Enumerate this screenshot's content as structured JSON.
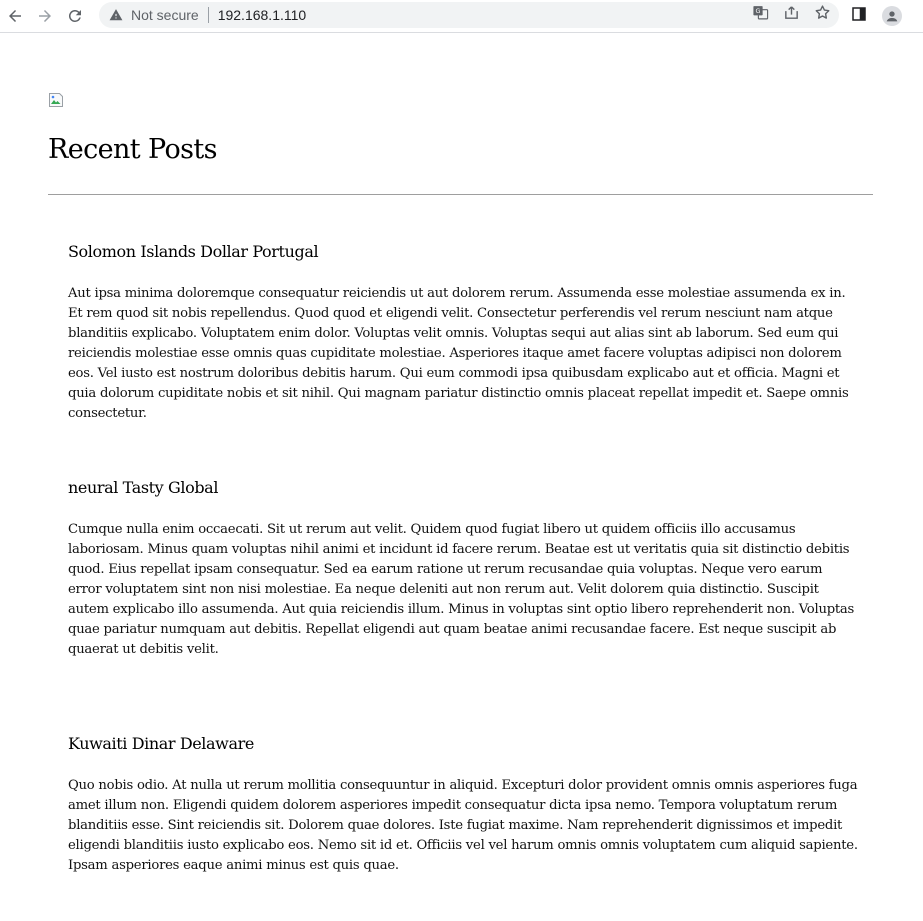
{
  "browser": {
    "security_label": "Not secure",
    "url": "192.168.1.110",
    "icons": {
      "back": "back-arrow-icon",
      "forward": "forward-arrow-icon",
      "reload": "reload-icon",
      "warning": "warning-icon",
      "translate": "translate-icon",
      "share": "share-icon",
      "bookmark": "star-icon",
      "sidepanel": "side-panel-icon",
      "profile": "profile-icon"
    }
  },
  "page": {
    "title": "Recent Posts",
    "posts": [
      {
        "title": "Solomon Islands Dollar Portugal",
        "body": "Aut ipsa minima doloremque consequatur reiciendis ut aut dolorem rerum. Assumenda esse molestiae assumenda ex in. Et rem quod sit nobis repellendus. Quod quod et eligendi velit. Consectetur perferendis vel rerum nesciunt nam atque blanditiis explicabo. Voluptatem enim dolor. Voluptas velit omnis. Voluptas sequi aut alias sint ab laborum. Sed eum qui reiciendis molestiae esse omnis quas cupiditate molestiae. Asperiores itaque amet facere voluptas adipisci non dolorem eos. Vel iusto est nostrum doloribus debitis harum. Qui eum commodi ipsa quibusdam explicabo aut et officia. Magni et quia dolorum cupiditate nobis et sit nihil. Qui magnam pariatur distinctio omnis placeat repellat impedit et. Saepe omnis consectetur."
      },
      {
        "title": "neural Tasty Global",
        "body": "Cumque nulla enim occaecati. Sit ut rerum aut velit. Quidem quod fugiat libero ut quidem officiis illo accusamus laboriosam. Minus quam voluptas nihil animi et incidunt id facere rerum. Beatae est ut veritatis quia sit distinctio debitis quod. Eius repellat ipsam consequatur. Sed ea earum ratione ut rerum recusandae quia voluptas. Neque vero earum error voluptatem sint non nisi molestiae. Ea neque deleniti aut non rerum aut. Velit dolorem quia distinctio. Suscipit autem explicabo illo assumenda. Aut quia reiciendis illum. Minus in voluptas sint optio libero reprehenderit non. Voluptas quae pariatur numquam aut debitis. Repellat eligendi aut quam beatae animi recusandae facere. Est neque suscipit ab quaerat ut debitis velit."
      },
      {
        "title": "Kuwaiti Dinar Delaware",
        "body": "Quo nobis odio. At nulla ut rerum mollitia consequuntur in aliquid. Excepturi dolor provident omnis omnis asperiores fuga amet illum non. Eligendi quidem dolorem asperiores impedit consequatur dicta ipsa nemo. Tempora voluptatum rerum blanditiis esse. Sint reiciendis sit. Dolorem quae dolores. Iste fugiat maxime. Nam reprehenderit dignissimos et impedit eligendi blanditiis iusto explicabo eos. Nemo sit id et. Officiis vel vel harum omnis omnis voluptatem cum aliquid sapiente. Ipsam asperiores eaque animi minus est quis quae."
      }
    ]
  }
}
